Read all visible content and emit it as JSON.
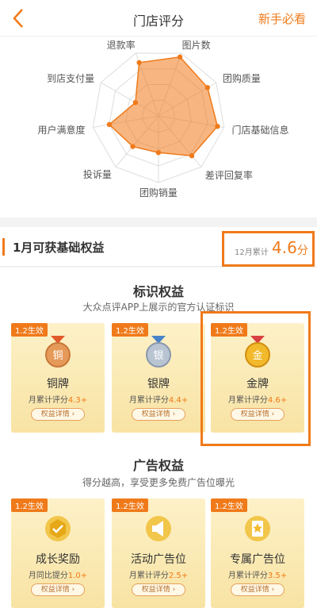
{
  "header": {
    "title": "门店评分",
    "right_link": "新手必看"
  },
  "radar": {
    "labels": [
      "图片数",
      "团购质量",
      "门店基础信息",
      "差评回复率",
      "团购销量",
      "投诉量",
      "用户满意度",
      "到店支付量",
      "退款率"
    ],
    "scores": [
      0.94,
      0.85,
      0.9,
      0.78,
      0.55,
      0.6,
      0.75,
      0.4,
      0.85
    ],
    "color": "#f07a1a"
  },
  "benefits": {
    "title": "1月可获基础权益"
  },
  "score": {
    "label": "12月累计",
    "value": "4.6",
    "unit": "分"
  },
  "section1": {
    "title": "标识权益",
    "subtitle": "大众点评APP上展示的官方认证标识",
    "cards": [
      {
        "tag": "1.2生效",
        "icon": "铜",
        "name": "铜牌",
        "desc_prefix": "月累计评分",
        "desc_value": "4.3+",
        "btn": "权益详情"
      },
      {
        "tag": "1.2生效",
        "icon": "银",
        "name": "银牌",
        "desc_prefix": "月累计评分",
        "desc_value": "4.4+",
        "btn": "权益详情"
      },
      {
        "tag": "1.2生效",
        "icon": "金",
        "name": "金牌",
        "desc_prefix": "月累计评分",
        "desc_value": "4.6+",
        "btn": "权益详情"
      }
    ]
  },
  "section2": {
    "title": "广告权益",
    "subtitle": "得分越高，享受更多免费广告位曝光",
    "cards": [
      {
        "tag": "1.2生效",
        "icon": "check-badge-icon",
        "name": "成长奖励",
        "desc_prefix": "月同比提分",
        "desc_value": "1.0+",
        "btn": "权益详情"
      },
      {
        "tag": "1.2生效",
        "icon": "megaphone-icon",
        "name": "活动广告位",
        "desc_prefix": "月累计评分",
        "desc_value": "2.5+",
        "btn": "权益详情"
      },
      {
        "tag": "1.2生效",
        "icon": "star-card-icon",
        "name": "专属广告位",
        "desc_prefix": "月累计评分",
        "desc_value": "3.5+",
        "btn": "权益详情"
      }
    ]
  }
}
